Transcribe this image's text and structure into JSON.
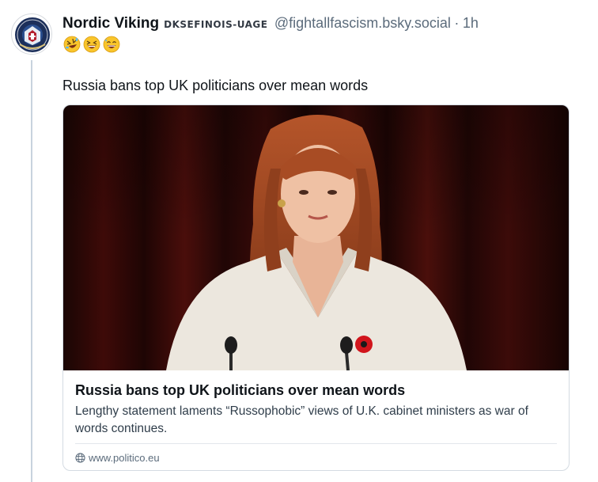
{
  "author": {
    "display_name": "Nordic Viking",
    "badge_text": "DKSEFINOIS-UAGE",
    "handle": "@fightallfascism.bsky.social",
    "separator": "·",
    "time": "1h"
  },
  "emojis": [
    "rolling-on-floor-laughing-emoji",
    "grinning-squinting-emoji",
    "grinning-sweat-emoji"
  ],
  "post": {
    "text": "Russia bans top UK politicians over mean words"
  },
  "link_card": {
    "title": "Russia bans top UK politicians over mean words",
    "description": "Lengthy statement laments “Russophobic” views of U.K. cabinet ministers as war of words continues.",
    "domain": "www.politico.eu",
    "domain_icon": "globe-icon"
  },
  "colors": {
    "text": "#0f1419",
    "muted": "#5b6b7b",
    "thread_line": "#c8d3de",
    "card_border": "#d4dbe2"
  }
}
